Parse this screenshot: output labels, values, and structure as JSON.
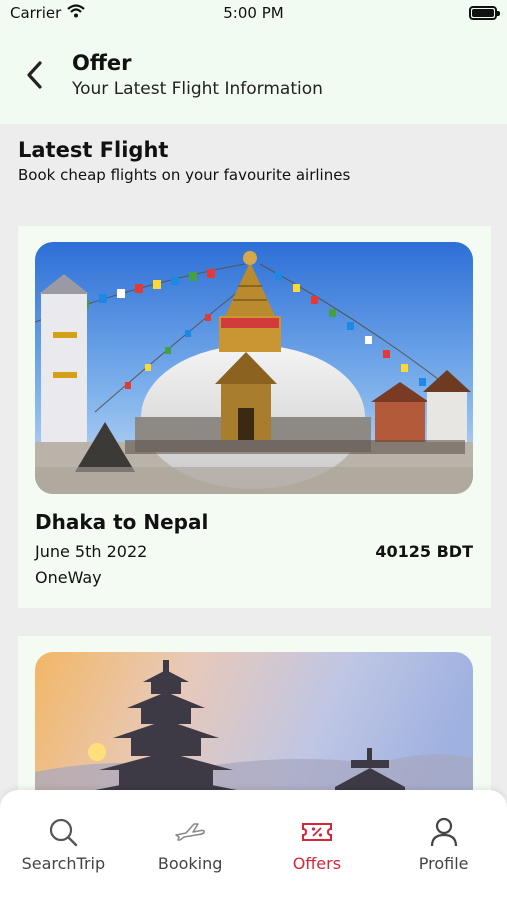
{
  "status_bar": {
    "carrier": "Carrier",
    "time": "5:00 PM"
  },
  "header": {
    "title": "Offer",
    "subtitle": "Your Latest Flight Information"
  },
  "section": {
    "title": "Latest Flight",
    "subtitle": "Book cheap flights on your favourite airlines"
  },
  "flights": [
    {
      "route": "Dhaka to Nepal",
      "date": "June 5th 2022",
      "price": "40125 BDT",
      "trip_type": "OneWay"
    }
  ],
  "bottom_nav": {
    "items": [
      {
        "label": "SearchTrip",
        "icon": "search-icon"
      },
      {
        "label": "Booking",
        "icon": "airplane-icon"
      },
      {
        "label": "Offers",
        "icon": "offer-ticket-icon",
        "active": true
      },
      {
        "label": "Profile",
        "icon": "profile-icon"
      }
    ],
    "active_color": "#d72638"
  }
}
